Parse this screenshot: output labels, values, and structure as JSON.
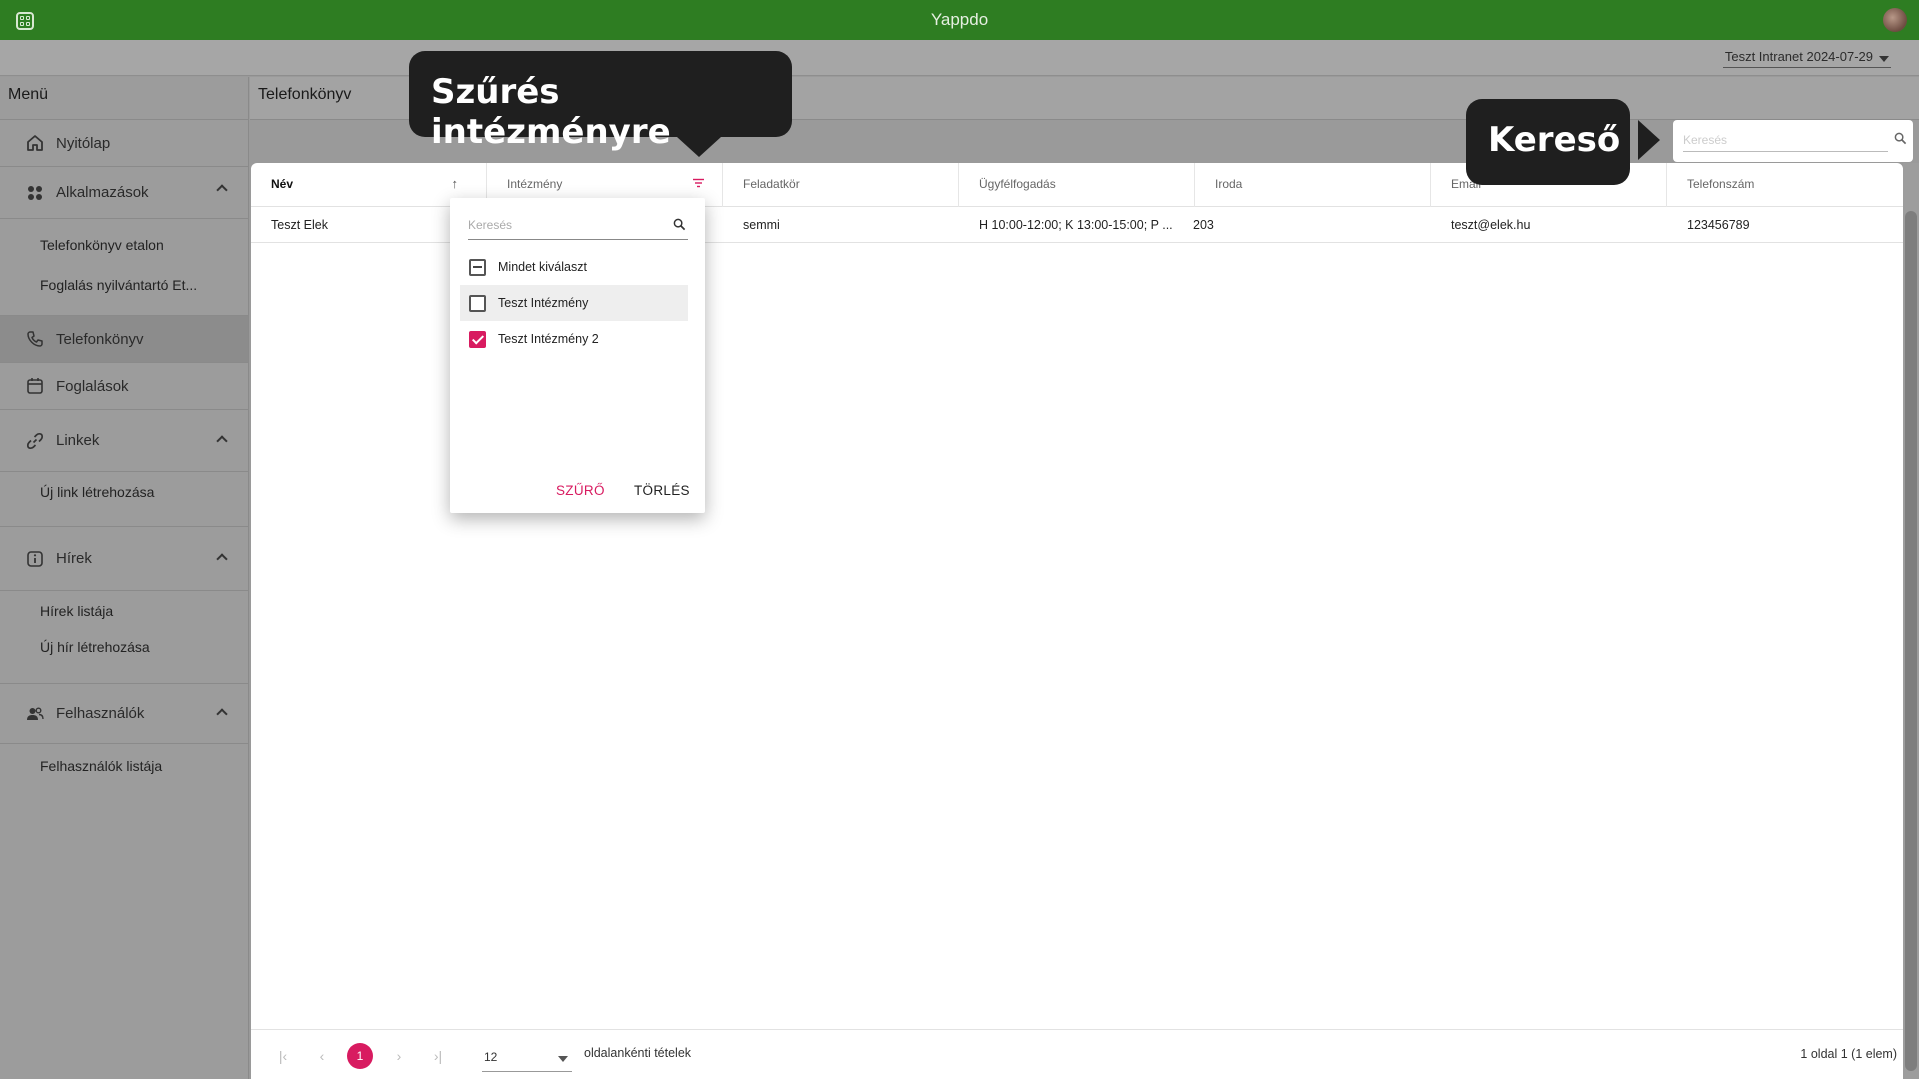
{
  "app": {
    "title": "Yappdo",
    "tenant": "Teszt Intranet 2024-07-29"
  },
  "sidebar": {
    "heading": "Menü",
    "items": [
      {
        "label": "Nyitólap"
      },
      {
        "label": "Alkalmazások",
        "children": [
          "Telefonkönyv etalon",
          "Foglalás nyilvántartó Et..."
        ]
      },
      {
        "label": "Telefonkönyv"
      },
      {
        "label": "Foglalások"
      },
      {
        "label": "Linkek",
        "children": [
          "Új link létrehozása"
        ]
      },
      {
        "label": "Hírek",
        "children": [
          "Hírek listája",
          "Új hír létrehozása"
        ]
      },
      {
        "label": "Felhasználók",
        "children": [
          "Felhasználók listája"
        ]
      }
    ]
  },
  "page": {
    "title": "Telefonkönyv"
  },
  "search": {
    "placeholder": "Keresés"
  },
  "table": {
    "columns": [
      "Név",
      "Intézmény",
      "Feladatkör",
      "Ügyfélfogadás",
      "Iroda",
      "Email",
      "Telefonszám"
    ],
    "rows": [
      [
        "Teszt Elek",
        "",
        "semmi",
        "H 10:00-12:00; K 13:00-15:00; P ...",
        "203",
        "teszt@elek.hu",
        "123456789"
      ]
    ]
  },
  "filter_popup": {
    "search_placeholder": "Keresés",
    "options": [
      {
        "label": "Mindet kiválaszt",
        "state": "indeterminate"
      },
      {
        "label": "Teszt Intézmény",
        "state": "unchecked"
      },
      {
        "label": "Teszt Intézmény 2",
        "state": "checked"
      }
    ],
    "apply_label": "SZŰRŐ",
    "clear_label": "TÖRLÉS"
  },
  "pagination": {
    "first": "|‹",
    "prev": "‹",
    "current": "1",
    "next": "›",
    "last": "›|",
    "page_size": "12",
    "page_size_label": "oldalankénti tételek",
    "summary": "1 oldal 1 (1 elem)"
  },
  "callouts": {
    "filter": "Szűrés intézményre",
    "search": "Kereső"
  },
  "colors": {
    "topbar": "#2e7d22",
    "accent": "#d81b60",
    "callout": "#1f1f1f"
  }
}
